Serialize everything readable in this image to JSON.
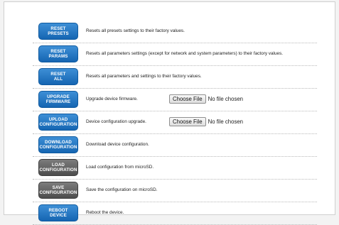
{
  "rows": [
    {
      "btn1": "Reset",
      "btn2": "Presets",
      "desc": "Resets all presets settings to their factory values."
    },
    {
      "btn1": "Reset",
      "btn2": "Params",
      "desc": "Resets all parameters settings (except for network and system parameters) to their factory values."
    },
    {
      "btn1": "Reset",
      "btn2": "All",
      "desc": "Resets all parameters and settings to their factory values."
    },
    {
      "btn1": "Upgrade",
      "btn2": "Firmware",
      "desc": "Upgrade device firmware.",
      "choose": "Choose File",
      "nofile": "No file chosen"
    },
    {
      "btn1": "Upload",
      "btn2": "Configuration",
      "desc": "Device configuration upgrade.",
      "choose": "Choose File",
      "nofile": "No file chosen"
    },
    {
      "btn1": "Download",
      "btn2": "Configuration",
      "desc": "Download device configuration."
    },
    {
      "btn1": "Load",
      "btn2": "Configuration",
      "desc": "Load configuration from microSD."
    },
    {
      "btn1": "Save",
      "btn2": "Configuration",
      "desc": "Save the configuration on microSD."
    },
    {
      "btn1": "Reboot",
      "btn2": "Device",
      "desc": "Reboot the device."
    }
  ],
  "colors": {
    "blue_button": "#1f74c3",
    "gray_button": "#5a5a5a"
  }
}
